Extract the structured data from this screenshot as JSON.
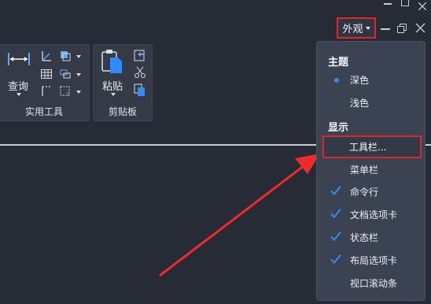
{
  "ribbon": {
    "tools_group": {
      "label": "实用工具",
      "query_label": "查询"
    },
    "clipboard_group": {
      "label": "剪贴板",
      "paste_label": "粘贴"
    }
  },
  "appearance_button": {
    "label": "外观"
  },
  "menu": {
    "theme_header": "主题",
    "theme_options": [
      {
        "label": "深色",
        "selected": true
      },
      {
        "label": "浅色",
        "selected": false
      }
    ],
    "display_header": "显示",
    "display_items": [
      {
        "label": "工具栏...",
        "checked": false
      },
      {
        "label": "菜单栏",
        "checked": false
      },
      {
        "label": "命令行",
        "checked": true
      },
      {
        "label": "文档选项卡",
        "checked": true
      },
      {
        "label": "状态栏",
        "checked": true
      },
      {
        "label": "布局选项卡",
        "checked": true
      },
      {
        "label": "视口滚动条",
        "checked": false
      }
    ]
  },
  "colors": {
    "background": "#262b36",
    "menu_bg": "#3b4352",
    "highlight_red": "#e0262d",
    "accent_blue": "#2f8cff"
  }
}
